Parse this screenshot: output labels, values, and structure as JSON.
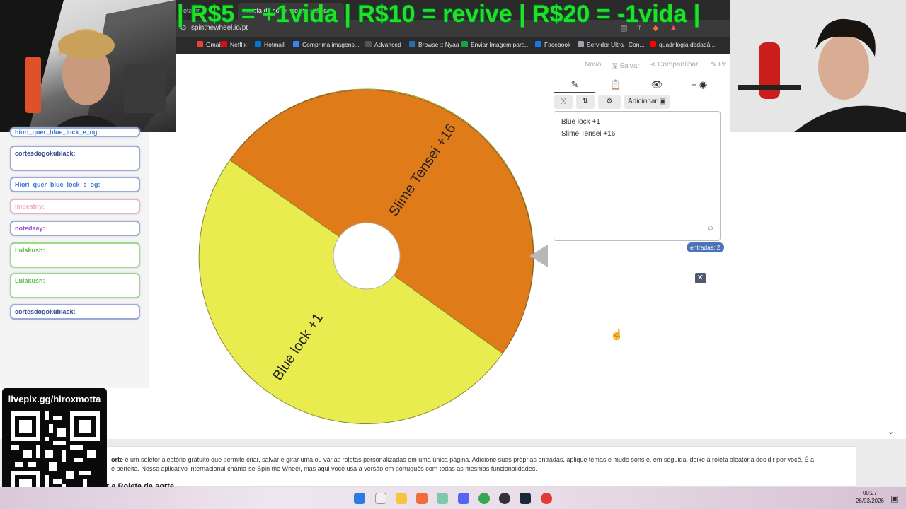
{
  "banner": {
    "text": "| R$5 = +1vida | R$10 = revive | R$20 = -1vida |"
  },
  "browser": {
    "tabs": [
      {
        "label": "rotator..."
      },
      {
        "label": "Roleta da sorte - roleta online"
      }
    ],
    "url": "spinthewheel.io/pt",
    "bookmarks": [
      {
        "label": "Gmail",
        "color": "#ea4335"
      },
      {
        "label": "Netflix",
        "color": "#e50914"
      },
      {
        "label": "Hotmail",
        "color": "#0078d4"
      },
      {
        "label": "Comprima imagens...",
        "color": "#3b82f6"
      },
      {
        "label": "Advanced",
        "color": "#555555"
      },
      {
        "label": "Browse :: Nyaa",
        "color": "#2b6cb0"
      },
      {
        "label": "Enviar Imagem para...",
        "color": "#16a34a"
      },
      {
        "label": "Facebook",
        "color": "#1877f2"
      },
      {
        "label": "Servidor Ultra | Con...",
        "color": "#9ca3af"
      },
      {
        "label": "quadrilogia dedadâ...",
        "color": "#ff0000"
      }
    ]
  },
  "toolbar": {
    "new": "Novo",
    "save": "Salvar",
    "share": "Compartilhar",
    "more": "Pr"
  },
  "chat": [
    {
      "user": "hiori_quer_blue_lock_e_og:",
      "text": "",
      "color": "#3b7bd4"
    },
    {
      "user": "cortesdogokublack:",
      "text": "",
      "color": "#334c8c"
    },
    {
      "user": "Hiori_quer_blue_lock_e_og:",
      "text": "",
      "color": "#3b7bd4"
    },
    {
      "user": "linceatny:",
      "text": "",
      "color": "#e07aa0"
    },
    {
      "user": "notedaay:",
      "text": "",
      "color": "#9b4fcf"
    },
    {
      "user": "Lulakush:",
      "text": "",
      "color": "#5fbf4a"
    },
    {
      "user": "Lulakush:",
      "text": "",
      "color": "#5fbf4a"
    },
    {
      "user": "cortesdogokublack:",
      "text": "",
      "color": "#334c8c"
    }
  ],
  "wheel": {
    "segments": [
      {
        "label": "Slime Tensei +16",
        "color": "#e07b1a"
      },
      {
        "label": "Blue lock +1",
        "color": "#e9ec4f"
      }
    ]
  },
  "editor": {
    "add_button": "Adicionar",
    "entries": [
      "Blue lock +1",
      "Slime Tensei +16"
    ],
    "entries_count_label": "entradas: 2"
  },
  "description": {
    "line1_bold": "orte",
    "line1": " é um seletor aleatório gratuito que permite criar, salvar e girar uma ou várias roletas personalizadas em uma única página. Adicione suas próprias entradas, aplique temas e mude sons e, em seguida, deixe a roleta aleatória decidir por você. É a",
    "line2": "e perfeita. Nosso aplicativo internacional chama-se Spin the Wheel, mas aqui você usa a versão em português com todas as mesmas funcionalidades.",
    "subheading": "r a Roleta da sorte"
  },
  "qr": {
    "title": "livepix.gg/hiroxmotta"
  },
  "taskbar": {
    "time": "00:27",
    "date": "26/03/2026"
  }
}
